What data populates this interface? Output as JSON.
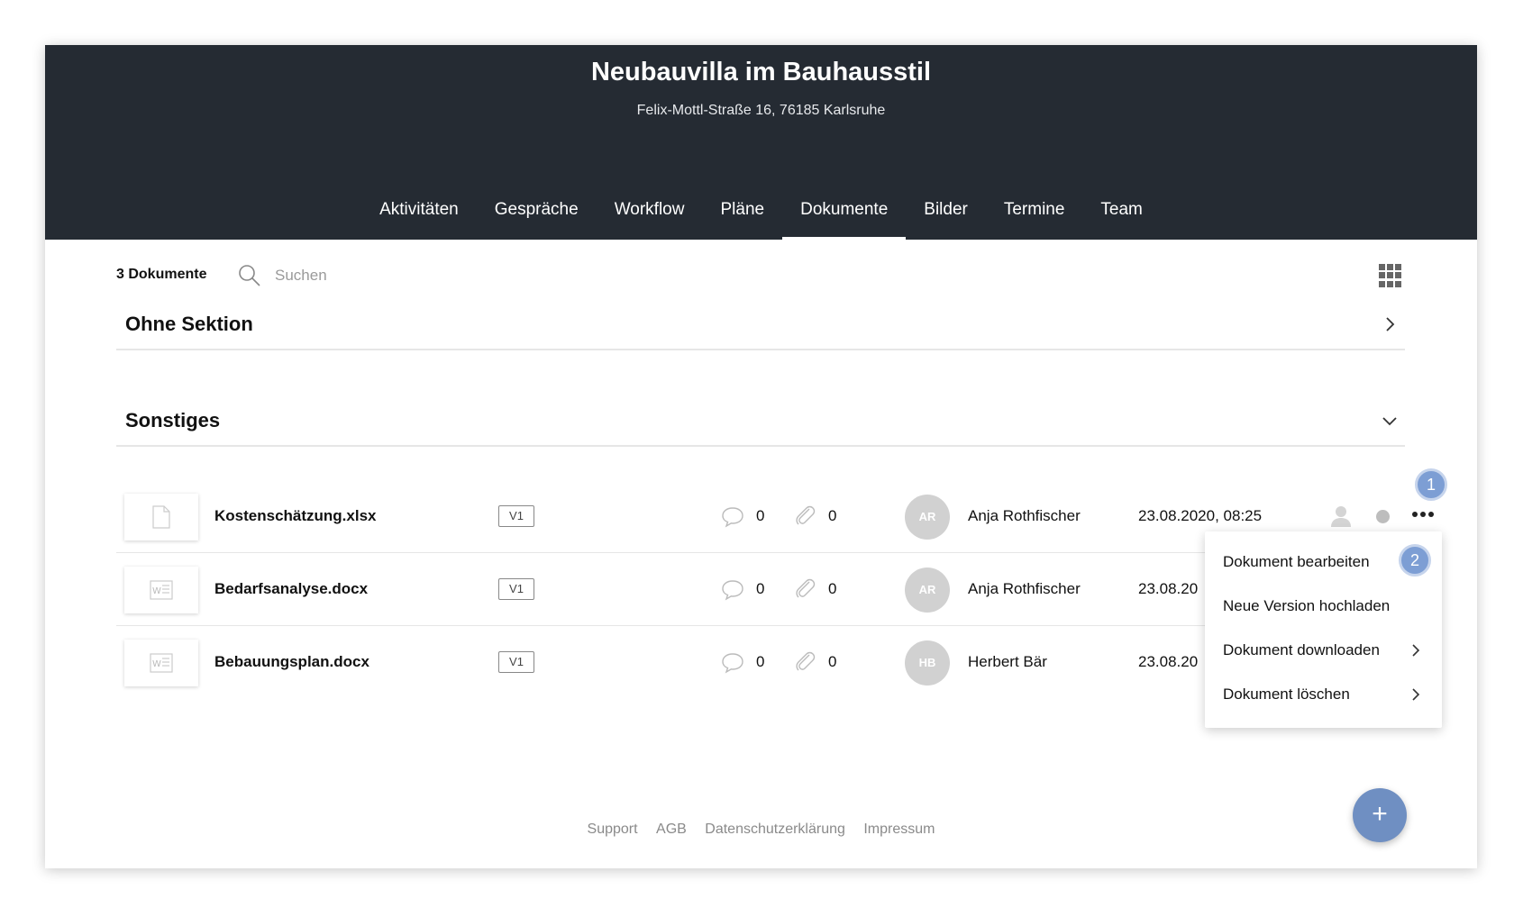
{
  "header": {
    "title": "Neubauvilla im Bauhausstil",
    "address": "Felix-Mottl-Straße 16, 76185 Karlsruhe"
  },
  "nav": {
    "tabs": [
      {
        "label": "Aktivitäten"
      },
      {
        "label": "Gespräche"
      },
      {
        "label": "Workflow"
      },
      {
        "label": "Pläne"
      },
      {
        "label": "Dokumente",
        "active": true
      },
      {
        "label": "Bilder"
      },
      {
        "label": "Termine"
      },
      {
        "label": "Team"
      }
    ]
  },
  "toolbar": {
    "doc_count": "3 Dokumente",
    "search_placeholder": "Suchen",
    "view_icon": "grid-view-icon"
  },
  "sections": [
    {
      "title": "Ohne Sektion",
      "state": "collapsed"
    },
    {
      "title": "Sonstiges",
      "state": "expanded"
    }
  ],
  "documents": [
    {
      "name": "Kostenschätzung.xlsx",
      "file_icon": "blank-file-icon",
      "version": "V1",
      "comments": "0",
      "attachments": "0",
      "avatar": "AR",
      "author": "Anja Rothfischer",
      "date": "23.08.2020, 08:25"
    },
    {
      "name": "Bedarfsanalyse.docx",
      "file_icon": "word-file-icon",
      "version": "V1",
      "comments": "0",
      "attachments": "0",
      "avatar": "AR",
      "author": "Anja Rothfischer",
      "date": "23.08.20"
    },
    {
      "name": "Bebauungsplan.docx",
      "file_icon": "word-file-icon",
      "version": "V1",
      "comments": "0",
      "attachments": "0",
      "avatar": "HB",
      "author": "Herbert Bär",
      "date": "23.08.20"
    }
  ],
  "markers": {
    "first": "1",
    "second": "2"
  },
  "context_menu": {
    "items": [
      {
        "label": "Dokument bearbeiten"
      },
      {
        "label": "Neue Version hochladen"
      },
      {
        "label": "Dokument downloaden",
        "submenu": true
      },
      {
        "label": "Dokument löschen",
        "submenu": true
      }
    ]
  },
  "footer": {
    "links": [
      "Support",
      "AGB",
      "Datenschutzerklärung",
      "Impressum"
    ]
  },
  "fab": {
    "label": "+"
  },
  "colors": {
    "header_bg": "#252b33",
    "accent": "#6f8fc2",
    "marker": "#7d9ed4",
    "avatar_bg": "#d1d1d1"
  }
}
